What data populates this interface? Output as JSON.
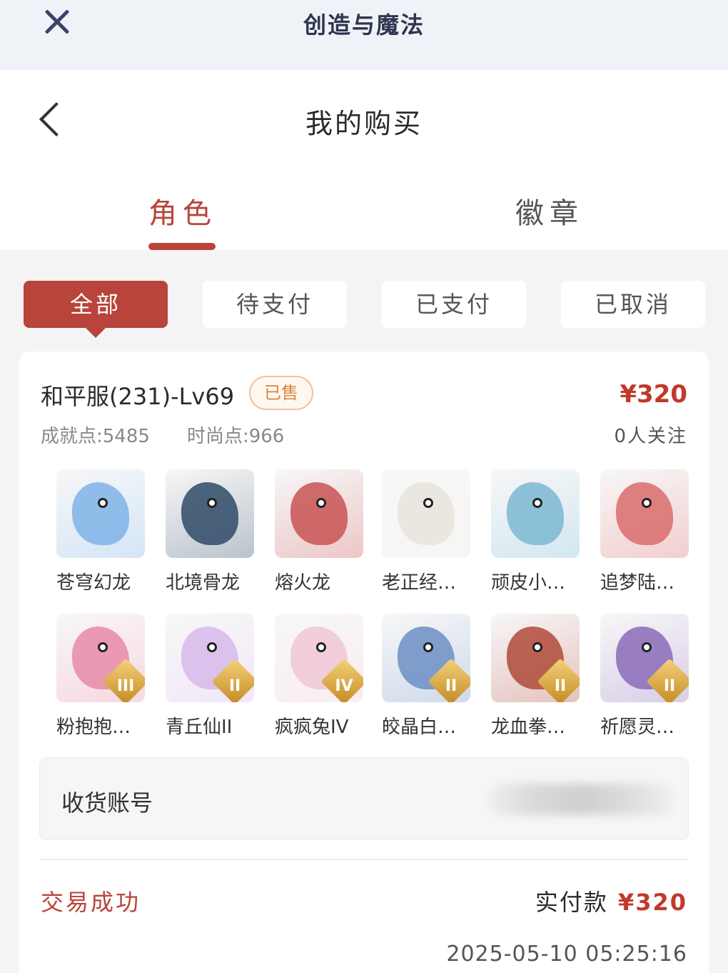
{
  "app": {
    "title": "创造与魔法"
  },
  "header": {
    "title": "我的购买"
  },
  "tabs": [
    {
      "label": "角色",
      "active": true
    },
    {
      "label": "徽章",
      "active": false
    }
  ],
  "filters": [
    {
      "label": "全部",
      "active": true
    },
    {
      "label": "待支付",
      "active": false
    },
    {
      "label": "已支付",
      "active": false
    },
    {
      "label": "已取消",
      "active": false
    }
  ],
  "order": {
    "server": "和平服(231)-Lv69",
    "sold_badge": "已售",
    "price": "¥320",
    "achievement": "成就点:5485",
    "fashion": "时尚点:966",
    "followers": "0人关注",
    "items": [
      {
        "name": "苍穹幻龙",
        "color": "#7fb3e6",
        "tier": "",
        "icon": "sky-dragon-icon"
      },
      {
        "name": "北境骨龙",
        "color": "#2f4a66",
        "tier": "",
        "icon": "bone-dragon-icon"
      },
      {
        "name": "熔火龙",
        "color": "#c85454",
        "tier": "",
        "icon": "fire-dragon-icon"
      },
      {
        "name": "老正经…",
        "color": "#e8e4dc",
        "tier": "",
        "icon": "goose-icon"
      },
      {
        "name": "顽皮小…",
        "color": "#7bb7d4",
        "tier": "",
        "icon": "sea-serpent-icon"
      },
      {
        "name": "追梦陆…",
        "color": "#d96c6c",
        "tier": "",
        "icon": "bird-icon"
      },
      {
        "name": "粉抱抱…",
        "color": "#e88aa8",
        "tier": "III",
        "icon": "bear-icon"
      },
      {
        "name": "青丘仙II",
        "color": "#d7b8ea",
        "tier": "II",
        "icon": "fox-fairy-icon"
      },
      {
        "name": "疯疯兔IV",
        "color": "#f0c7d5",
        "tier": "IV",
        "icon": "rabbit-icon"
      },
      {
        "name": "皎晶白…",
        "color": "#6c8fc4",
        "tier": "II",
        "icon": "white-tiger-icon"
      },
      {
        "name": "龙血拳…",
        "color": "#b04a3a",
        "tier": "II",
        "icon": "dragon-fist-icon"
      },
      {
        "name": "祈愿灵…",
        "color": "#8a6bb8",
        "tier": "II",
        "icon": "griffin-icon"
      }
    ],
    "account_label": "收货账号",
    "status": "交易成功",
    "paid_label": "实付款",
    "paid_amount": "¥320",
    "datetime": "2025-05-10 05:25:16"
  }
}
